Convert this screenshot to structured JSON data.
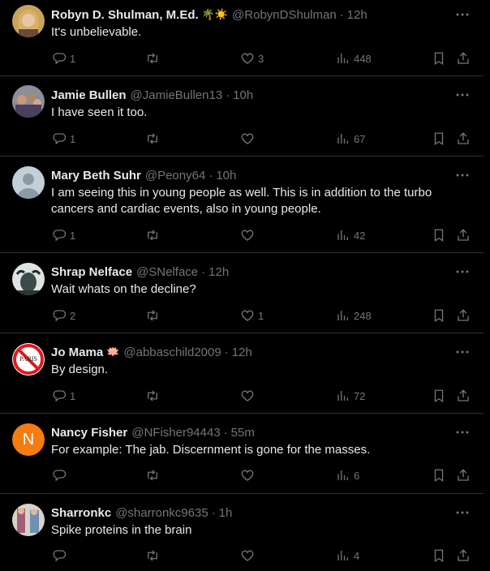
{
  "tweets": [
    {
      "name": "Robyn D. Shulman, M.Ed.",
      "emoji": "🌴☀️",
      "handle": "@RobynDShulman",
      "time": "12h",
      "text": [
        "It's unbelievable."
      ],
      "replies": "1",
      "likes": "3",
      "views": "448"
    },
    {
      "name": "Jamie Bullen",
      "emoji": "",
      "handle": "@JamieBullen13",
      "time": "10h",
      "text": [
        "I have seen it too."
      ],
      "replies": "1",
      "likes": "",
      "views": "67"
    },
    {
      "name": "Mary Beth Suhr",
      "emoji": "",
      "handle": "@Peony64",
      "time": "10h",
      "text": [
        "I am seeing this in young people as well. This is in addition to the turbo",
        "cancers and cardiac events, also in young people."
      ],
      "replies": "1",
      "likes": "",
      "views": "42"
    },
    {
      "name": "Shrap Nelface",
      "emoji": "",
      "handle": "@SNelface",
      "time": "12h",
      "text": [
        "Wait whats on the decline?"
      ],
      "replies": "2",
      "likes": "1",
      "views": "248"
    },
    {
      "name": "Jo Mama",
      "emoji": "🪷",
      "handle": "@abbaschild2009",
      "time": "12h",
      "text": [
        "By design."
      ],
      "replies": "1",
      "likes": "",
      "views": "72"
    },
    {
      "name": "Nancy Fisher",
      "emoji": "",
      "handle": "@NFisher94443",
      "time": "55m",
      "text": [
        "For example: The jab. Discernment is gone for the masses."
      ],
      "replies": "",
      "likes": "",
      "views": "6"
    },
    {
      "name": "Sharronkc",
      "emoji": "",
      "handle": "@sharronkc9635",
      "time": "1h",
      "text": [
        "Spike proteins in the brain"
      ],
      "replies": "",
      "likes": "",
      "views": "4"
    }
  ],
  "avatars": {
    "nancy_initial": "N",
    "jo_mama_badge": "PARIS"
  },
  "colors": {
    "background": "#000000",
    "text": "#e7e9ea",
    "muted": "#71767b",
    "divider": "#2f3336",
    "nancy_avatar": "#f47c11"
  },
  "icons": [
    "reply-icon",
    "retweet-icon",
    "like-icon",
    "views-icon",
    "bookmark-icon",
    "share-icon",
    "more-icon"
  ]
}
